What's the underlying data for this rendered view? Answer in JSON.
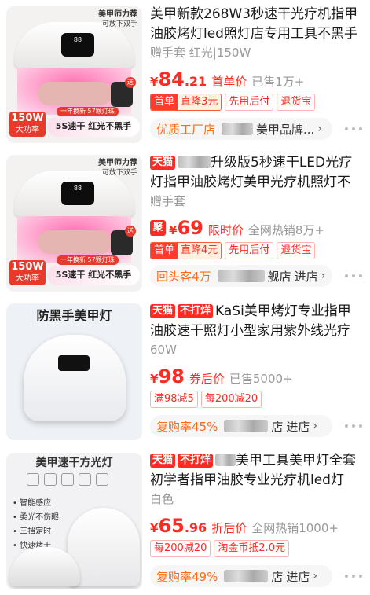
{
  "items": [
    {
      "title": "美甲新款268W3秒速干光疗机指甲油胶烤灯led照灯店专用工具不黑手",
      "subtitle": "赠手套 红光|150W",
      "price_int": "84",
      "price_dec": ".21",
      "price_label": "首单价",
      "sold": "已售1万+",
      "badge_combo_left": "首单",
      "badge_combo_right": "直降3元",
      "badges": [
        "先用后付",
        "退货宝"
      ],
      "store_accent": "优质工厂店",
      "store_name": "美甲品牌...",
      "store_enter": "",
      "thumb": {
        "ribbon": "美甲师力荐",
        "ribbon_sub": "可放下双手",
        "watt": "150W",
        "watt_sub": "大功率",
        "promo": "5S速干 红光不黑手",
        "pill": "一年换新 57颗灯珠",
        "send": "送"
      }
    },
    {
      "tag": "天猫",
      "title_rest": "升级版5秒速干LED光疗灯指甲油胶烤灯美甲光疗机照灯不",
      "subtitle": "赠手套",
      "ju": "聚",
      "price_int": "69",
      "price_label": "限时价",
      "sold": "全网热销8万+",
      "badge_combo_left": "首单",
      "badge_combo_right": "直降4元",
      "badges": [
        "先用后付",
        "退货宝"
      ],
      "store_accent": "回头客4万",
      "store_name": "舰店",
      "store_enter": "进店",
      "thumb": {
        "ribbon": "美甲师力荐",
        "ribbon_sub": "可放下双手",
        "watt": "150W",
        "watt_sub": "大功率",
        "promo": "5S速干 红光不黑手",
        "pill": "一年换新 57颗灯珠",
        "send": "送"
      }
    },
    {
      "tag1": "天猫",
      "tag2": "不打烊",
      "title_rest": "KaSi美甲烤灯专业指甲油胶速干照灯小型家用紫外线光疗",
      "subtitle": "60W",
      "price_int": "98",
      "price_label": "券后价",
      "sold": "已售5000+",
      "badges": [
        "满98减5",
        "每200减20"
      ],
      "store_accent": "复购率45%",
      "store_name": "店",
      "store_enter": "进店",
      "thumb": {
        "title": "防黑手美甲灯"
      }
    },
    {
      "tag1": "天猫",
      "tag2": "不打烊",
      "title_rest": "美甲工具美甲灯全套初学者指甲油胶专业光疗机led灯",
      "subtitle": "白色",
      "price_int": "65",
      "price_dec": ".96",
      "price_label": "折后价",
      "sold": "全网热销1000+",
      "badges": [
        "每200减20",
        "淘金币抵2.0元"
      ],
      "store_accent": "复购率49%",
      "store_name": "店",
      "store_enter": "进店",
      "thumb": {
        "title": "美甲速干方光灯",
        "features": [
          "• 智能感应",
          "• 柔光不伤眼",
          "• 三挡定时",
          "• 快速烤干"
        ]
      }
    }
  ],
  "currency": "¥",
  "chevron": "›",
  "colors": {
    "accent": "#ff2a23",
    "store_accent": "#ff6a1a",
    "tmall": "#ff2a23"
  }
}
